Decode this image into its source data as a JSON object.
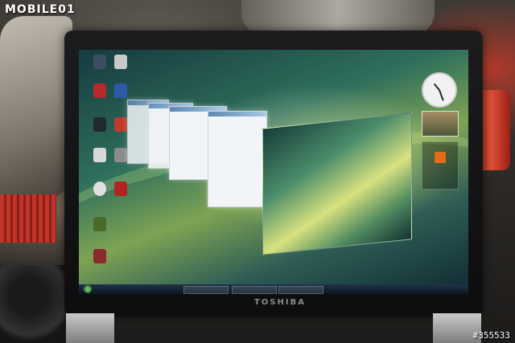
{
  "logo": {
    "text": "MOBILE01"
  },
  "watermark": {
    "text": "#355533"
  },
  "laptop": {
    "brand": "TOSHIBA"
  },
  "colors": {
    "wallpaper_accent": "#7ea353",
    "rss_orange": "#e36c1a"
  }
}
